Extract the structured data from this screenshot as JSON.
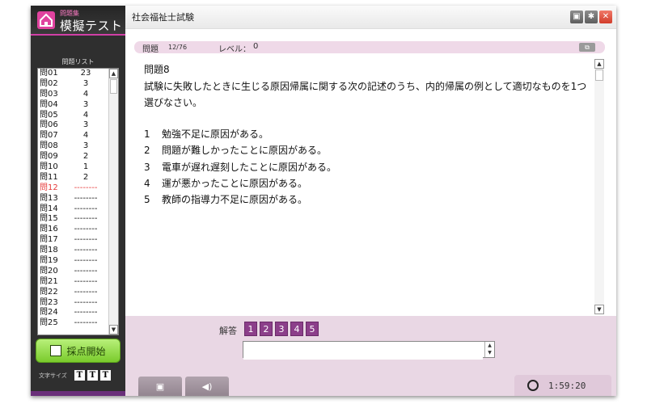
{
  "logo": {
    "small": "問題集",
    "big": "模擬テスト"
  },
  "app": {
    "title": "社会福祉士試験"
  },
  "question_list": {
    "title": "問題リスト",
    "rows": [
      {
        "q": "問01",
        "v": "23"
      },
      {
        "q": "問02",
        "v": "3"
      },
      {
        "q": "問03",
        "v": "4"
      },
      {
        "q": "問04",
        "v": "3"
      },
      {
        "q": "問05",
        "v": "4"
      },
      {
        "q": "問06",
        "v": "3"
      },
      {
        "q": "問07",
        "v": "4"
      },
      {
        "q": "問08",
        "v": "3"
      },
      {
        "q": "問09",
        "v": "2"
      },
      {
        "q": "問10",
        "v": "1"
      },
      {
        "q": "問11",
        "v": "2"
      },
      {
        "q": "問12",
        "v": "--------"
      },
      {
        "q": "問13",
        "v": "--------"
      },
      {
        "q": "問14",
        "v": "--------"
      },
      {
        "q": "問15",
        "v": "--------"
      },
      {
        "q": "問16",
        "v": "--------"
      },
      {
        "q": "問17",
        "v": "--------"
      },
      {
        "q": "問18",
        "v": "--------"
      },
      {
        "q": "問19",
        "v": "--------"
      },
      {
        "q": "問20",
        "v": "--------"
      },
      {
        "q": "問21",
        "v": "--------"
      },
      {
        "q": "問22",
        "v": "--------"
      },
      {
        "q": "問23",
        "v": "--------"
      },
      {
        "q": "問24",
        "v": "--------"
      },
      {
        "q": "問25",
        "v": "--------"
      }
    ],
    "current_index": 11
  },
  "score_button": "採点開始",
  "font_size": {
    "label": "文字サイズ",
    "buttons": [
      "T",
      "T",
      "T"
    ]
  },
  "question_header": {
    "label": "問題",
    "number": "12/76",
    "level_label": "レベル：",
    "level": "0"
  },
  "question": {
    "title": "問題8",
    "text": "試験に失敗したときに生じる原因帰属に関する次の記述のうち、内的帰属の例として適切なものを1つ選びなさい。",
    "options": [
      {
        "n": "1",
        "text": "勉強不足に原因がある。"
      },
      {
        "n": "2",
        "text": "問題が難しかったことに原因がある。"
      },
      {
        "n": "3",
        "text": "電車が遅れ遅刻したことに原因がある。"
      },
      {
        "n": "4",
        "text": "運が悪かったことに原因がある。"
      },
      {
        "n": "5",
        "text": "教師の指導力不足に原因がある。"
      }
    ]
  },
  "answer": {
    "label": "解答",
    "choices": [
      "1",
      "2",
      "3",
      "4",
      "5"
    ],
    "value": ""
  },
  "timer": "1:59:20",
  "colors": {
    "accent": "#8c3f8a",
    "current": "#e63b3b",
    "score_button": "#7acb2c"
  }
}
